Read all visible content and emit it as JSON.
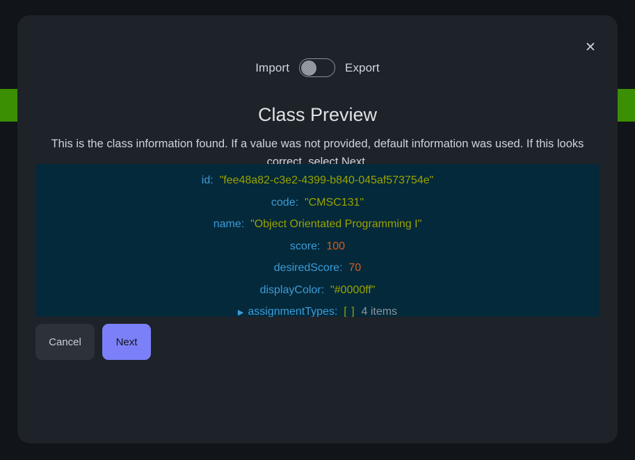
{
  "window": {
    "background_color": "#111418",
    "accent_block_color": "#3b8f02"
  },
  "modal": {
    "close_icon": "✕",
    "toggle": {
      "left_label": "Import",
      "right_label": "Export",
      "state": "left",
      "knob_color": "#8e979f"
    },
    "title": "Class Preview",
    "subtitle": "This is the class information found. If a value was not provided, default information was used. If this looks correct, select Next.",
    "preview": {
      "background_color": "#04293a",
      "key_color": "#3d9cd8",
      "string_color": "#9aa300",
      "number_color": "#d85c22",
      "rows": [
        {
          "key": "id",
          "separator": ":",
          "value": "\"fee48a82-c3e2-4399-b840-045af573754e\"",
          "type": "string"
        },
        {
          "key": "code",
          "separator": ":",
          "value": "\"CMSC131\"",
          "type": "string"
        },
        {
          "key": "name",
          "separator": ":",
          "value": "\"Object Orientated Programming I\"",
          "type": "string"
        },
        {
          "key": "score",
          "separator": ":",
          "value": "100",
          "type": "number"
        },
        {
          "key": "desiredScore",
          "separator": ":",
          "value": "70",
          "type": "number"
        },
        {
          "key": "displayColor",
          "separator": ":",
          "value": "\"#0000ff\"",
          "type": "string"
        },
        {
          "key": "assignmentTypes",
          "separator": ":",
          "value": "[ ]",
          "count": "4 items",
          "type": "array",
          "expander": "▶",
          "expanded": false
        }
      ]
    },
    "buttons": {
      "cancel_label": "Cancel",
      "next_label": "Next",
      "next_color": "#7b80f8"
    }
  }
}
